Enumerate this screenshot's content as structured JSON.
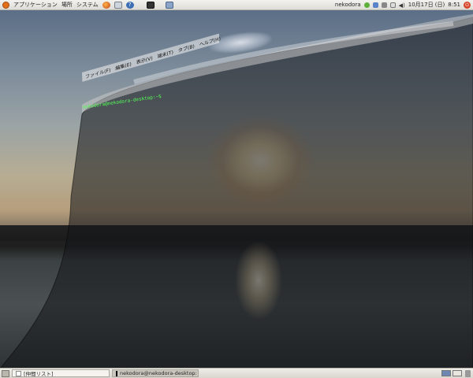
{
  "top_panel": {
    "menus": [
      "アプリケーション",
      "場所",
      "システム"
    ],
    "user": "nekodora",
    "datetime": "10月17日 (日)",
    "time": "8:51"
  },
  "terminal": {
    "menus": [
      "ファイル(F)",
      "編集(E)",
      "表示(V)",
      "端末(T)",
      "タブ(B)",
      "ヘルプ(H)"
    ],
    "prompt": "nekodora@nekodora-desktop:~$"
  },
  "bottom_panel": {
    "tasks": [
      {
        "label": "[仲間リスト]",
        "active": false
      },
      {
        "label": "nekodora@nekodora-desktop: ~",
        "active": true
      }
    ]
  }
}
